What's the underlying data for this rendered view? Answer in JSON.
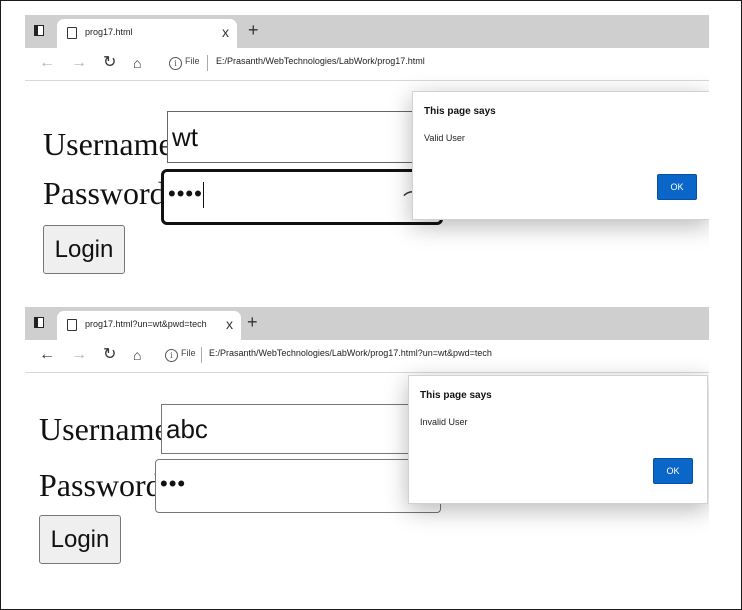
{
  "screens": [
    {
      "tab_title": "prog17.html",
      "tab_close": "x",
      "new_tab": "+",
      "info_icon": "i",
      "file_label": "File",
      "url": "E:/Prasanth/WebTechnologies/LabWork/prog17.html",
      "username_label": "Username:",
      "username_value": "wt",
      "password_label": "Password:",
      "password_value": "••••",
      "login_label": "Login",
      "dialog": {
        "title": "This page says",
        "message": "Valid User",
        "ok": "OK"
      }
    },
    {
      "tab_title": "prog17.html?un=wt&pwd=tech",
      "tab_close": "x",
      "new_tab": "+",
      "info_icon": "i",
      "file_label": "File",
      "url": "E:/Prasanth/WebTechnologies/LabWork/prog17.html?un=wt&pwd=tech",
      "username_label": "Username:",
      "username_value": "abc",
      "password_label": "Password:",
      "password_value": "•••",
      "login_label": "Login",
      "dialog": {
        "title": "This page says",
        "message": "Invalid User",
        "ok": "OK"
      }
    }
  ],
  "icons": {
    "back": "back-arrow-icon",
    "forward": "forward-arrow-icon",
    "reload": "reload-icon",
    "home": "home-icon",
    "info": "info-icon",
    "page": "page-icon",
    "tab_actions": "tab-actions-icon",
    "eye": "eye-icon"
  },
  "colors": {
    "tabstrip": "#cfcfcf",
    "ok_button": "#0a67c9",
    "focused_border": "#111111"
  }
}
